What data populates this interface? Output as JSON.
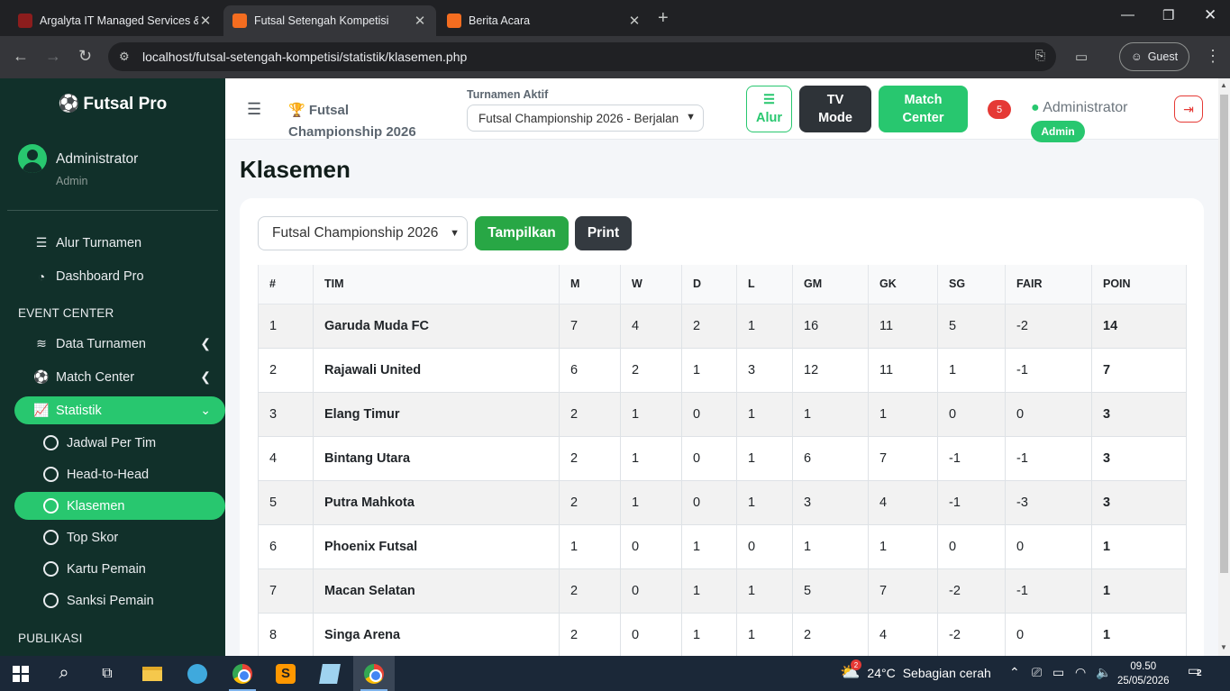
{
  "browser": {
    "tabs": [
      {
        "title": "Argalyta IT Managed Services &",
        "color": "#8c1d1d"
      },
      {
        "title": "Futsal Setengah Kompetisi",
        "color": "#f46d20"
      },
      {
        "title": "Berita Acara",
        "color": "#f46d20"
      }
    ],
    "url": "localhost/futsal-setengah-kompetisi/statistik/klasemen.php",
    "profile": "Guest"
  },
  "sidebar": {
    "brand": "Futsal Pro",
    "user_name": "Administrator",
    "user_role": "Admin",
    "items": [
      {
        "label": "Alur Turnamen",
        "icon": "list-check-icon"
      },
      {
        "label": "Dashboard Pro",
        "icon": "gauge-icon"
      }
    ],
    "section_event": "EVENT CENTER",
    "event_items": [
      {
        "label": "Data Turnamen",
        "icon": "layers-icon"
      },
      {
        "label": "Match Center",
        "icon": "soccer-ball-icon"
      },
      {
        "label": "Statistik",
        "icon": "chart-line-icon"
      }
    ],
    "sub_items": [
      "Jadwal Per Tim",
      "Head-to-Head",
      "Klasemen",
      "Top Skor",
      "Kartu Pemain",
      "Sanksi Pemain"
    ],
    "section_publikasi": "PUBLIKASI"
  },
  "topnav": {
    "tournament_name": "Futsal Championship 2026",
    "active_label": "Turnamen Aktif",
    "active_value": "Futsal Championship 2026 - Berjalan",
    "btn_alur": "Alur",
    "btn_tv": "TV Mode",
    "btn_match": "Match Center",
    "notif_count": "5",
    "admin_name": "Administrator",
    "admin_badge": "Admin"
  },
  "main": {
    "title": "Klasemen",
    "select_value": "Futsal Championship 2026",
    "btn_show": "Tampilkan",
    "btn_print": "Print",
    "columns": [
      "#",
      "TIM",
      "M",
      "W",
      "D",
      "L",
      "GM",
      "GK",
      "SG",
      "FAIR",
      "POIN"
    ],
    "rows": [
      [
        "1",
        "Garuda Muda FC",
        "7",
        "4",
        "2",
        "1",
        "16",
        "11",
        "5",
        "-2",
        "14"
      ],
      [
        "2",
        "Rajawali United",
        "6",
        "2",
        "1",
        "3",
        "12",
        "11",
        "1",
        "-1",
        "7"
      ],
      [
        "3",
        "Elang Timur",
        "2",
        "1",
        "0",
        "1",
        "1",
        "1",
        "0",
        "0",
        "3"
      ],
      [
        "4",
        "Bintang Utara",
        "2",
        "1",
        "0",
        "1",
        "6",
        "7",
        "-1",
        "-1",
        "3"
      ],
      [
        "5",
        "Putra Mahkota",
        "2",
        "1",
        "0",
        "1",
        "3",
        "4",
        "-1",
        "-3",
        "3"
      ],
      [
        "6",
        "Phoenix Futsal",
        "1",
        "0",
        "1",
        "0",
        "1",
        "1",
        "0",
        "0",
        "1"
      ],
      [
        "7",
        "Macan Selatan",
        "2",
        "0",
        "1",
        "1",
        "5",
        "7",
        "-2",
        "-1",
        "1"
      ],
      [
        "8",
        "Singa Arena",
        "2",
        "0",
        "1",
        "1",
        "2",
        "4",
        "-2",
        "0",
        "1"
      ]
    ]
  },
  "taskbar": {
    "weather_temp": "24°C",
    "weather_text": "Sebagian cerah",
    "weather_badge": "2",
    "time": "09.50",
    "date": "25/05/2026",
    "notif": "2"
  },
  "colors": {
    "accent": "#28c76f",
    "sidebar": "#11302a",
    "danger": "#e53935"
  }
}
